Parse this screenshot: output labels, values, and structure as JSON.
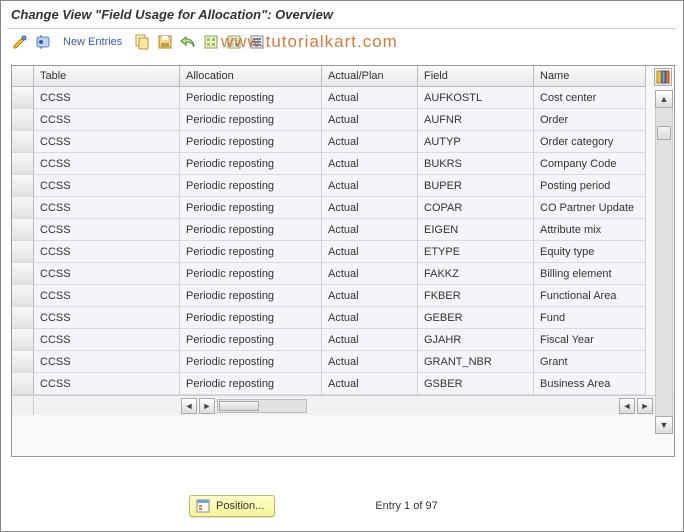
{
  "title": "Change View \"Field Usage for Allocation\": Overview",
  "watermark": "www.tutorialkart.com",
  "toolbar": {
    "new_entries": "New Entries"
  },
  "columns": [
    "Table",
    "Allocation",
    "Actual/Plan",
    "Field",
    "Name"
  ],
  "rows": [
    {
      "table": "CCSS",
      "allocation": "Periodic reposting",
      "actual_plan": "Actual",
      "field": "AUFKOSTL",
      "name": "Cost center"
    },
    {
      "table": "CCSS",
      "allocation": "Periodic reposting",
      "actual_plan": "Actual",
      "field": "AUFNR",
      "name": "Order"
    },
    {
      "table": "CCSS",
      "allocation": "Periodic reposting",
      "actual_plan": "Actual",
      "field": "AUTYP",
      "name": "Order category"
    },
    {
      "table": "CCSS",
      "allocation": "Periodic reposting",
      "actual_plan": "Actual",
      "field": "BUKRS",
      "name": "Company Code"
    },
    {
      "table": "CCSS",
      "allocation": "Periodic reposting",
      "actual_plan": "Actual",
      "field": "BUPER",
      "name": "Posting period"
    },
    {
      "table": "CCSS",
      "allocation": "Periodic reposting",
      "actual_plan": "Actual",
      "field": "COPAR",
      "name": "CO Partner Update"
    },
    {
      "table": "CCSS",
      "allocation": "Periodic reposting",
      "actual_plan": "Actual",
      "field": "EIGEN",
      "name": "Attribute mix"
    },
    {
      "table": "CCSS",
      "allocation": "Periodic reposting",
      "actual_plan": "Actual",
      "field": "ETYPE",
      "name": "Equity type"
    },
    {
      "table": "CCSS",
      "allocation": "Periodic reposting",
      "actual_plan": "Actual",
      "field": "FAKKZ",
      "name": "Billing element"
    },
    {
      "table": "CCSS",
      "allocation": "Periodic reposting",
      "actual_plan": "Actual",
      "field": "FKBER",
      "name": "Functional Area"
    },
    {
      "table": "CCSS",
      "allocation": "Periodic reposting",
      "actual_plan": "Actual",
      "field": "GEBER",
      "name": "Fund"
    },
    {
      "table": "CCSS",
      "allocation": "Periodic reposting",
      "actual_plan": "Actual",
      "field": "GJAHR",
      "name": "Fiscal Year"
    },
    {
      "table": "CCSS",
      "allocation": "Periodic reposting",
      "actual_plan": "Actual",
      "field": "GRANT_NBR",
      "name": "Grant"
    },
    {
      "table": "CCSS",
      "allocation": "Periodic reposting",
      "actual_plan": "Actual",
      "field": "GSBER",
      "name": "Business Area"
    }
  ],
  "footer": {
    "position_label": "Position...",
    "entry_counter": "Entry 1 of 97"
  }
}
